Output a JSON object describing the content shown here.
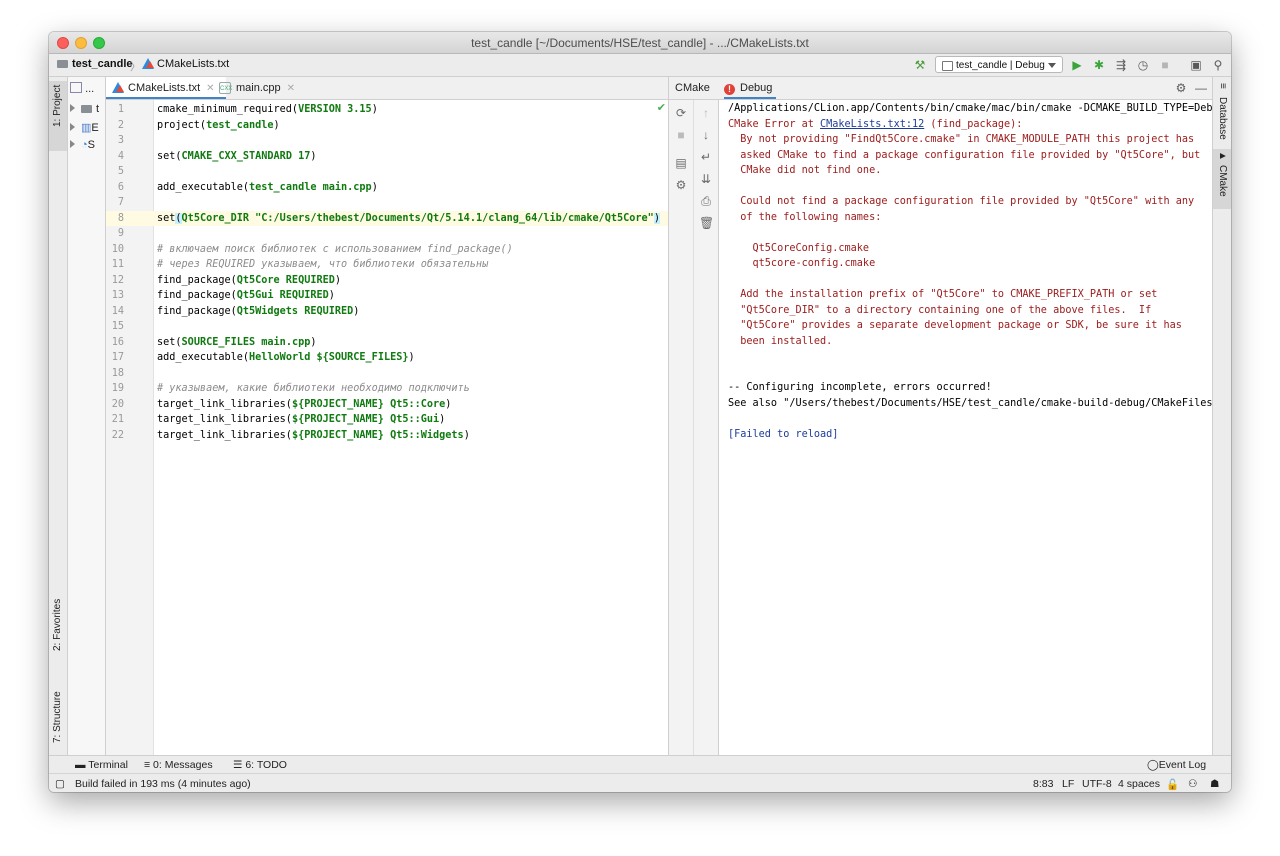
{
  "window": {
    "title": "test_candle [~/Documents/HSE/test_candle] - .../CMakeLists.txt"
  },
  "breadcrumb": {
    "project": "test_candle",
    "file": "CMakeLists.txt"
  },
  "toolbar": {
    "run_config": "test_candle | Debug"
  },
  "left_tool_tabs": {
    "project": "1: Project",
    "favorites": "2: Favorites",
    "structure": "7: Structure"
  },
  "project_tree": {
    "root_label": "...",
    "items": [
      "t",
      "E",
      "S"
    ]
  },
  "editor": {
    "tabs": [
      {
        "label": "CMakeLists.txt",
        "active": true
      },
      {
        "label": "main.cpp",
        "active": false
      }
    ],
    "lines": [
      {
        "n": "1",
        "parts": [
          [
            "",
            "cmake_minimum_required("
          ],
          [
            "kw",
            "VERSION 3.15"
          ],
          [
            "",
            ")"
          ]
        ]
      },
      {
        "n": "2",
        "parts": [
          [
            "",
            "project("
          ],
          [
            "kw",
            "test_candle"
          ],
          [
            "",
            ")"
          ]
        ]
      },
      {
        "n": "3",
        "parts": []
      },
      {
        "n": "4",
        "parts": [
          [
            "",
            "set("
          ],
          [
            "kw",
            "CMAKE_CXX_STANDARD 17"
          ],
          [
            "",
            ")"
          ]
        ]
      },
      {
        "n": "5",
        "parts": []
      },
      {
        "n": "6",
        "parts": [
          [
            "",
            "add_executable("
          ],
          [
            "kw",
            "test_candle main.cpp"
          ],
          [
            "",
            ")"
          ]
        ]
      },
      {
        "n": "7",
        "parts": []
      },
      {
        "n": "8",
        "current": true,
        "parts": [
          [
            "",
            "set"
          ],
          [
            "hl",
            "("
          ],
          [
            "kw",
            "Qt5Core_DIR \"C:/Users/thebest/Documents/Qt/5.14.1/clang_64/lib/cmake/Qt5Core\""
          ],
          [
            "hl",
            ")"
          ]
        ]
      },
      {
        "n": "9",
        "parts": []
      },
      {
        "n": "10",
        "parts": [
          [
            "cm",
            "# включаем поиск библиотек с использованием find_package()"
          ]
        ]
      },
      {
        "n": "11",
        "parts": [
          [
            "cm",
            "# через REQUIRED указываем, что библиотеки обязательны"
          ]
        ]
      },
      {
        "n": "12",
        "parts": [
          [
            "",
            "find_package("
          ],
          [
            "kw",
            "Qt5Core REQUIRED"
          ],
          [
            "",
            ")"
          ]
        ]
      },
      {
        "n": "13",
        "parts": [
          [
            "",
            "find_package("
          ],
          [
            "kw",
            "Qt5Gui REQUIRED"
          ],
          [
            "",
            ")"
          ]
        ]
      },
      {
        "n": "14",
        "parts": [
          [
            "",
            "find_package("
          ],
          [
            "kw",
            "Qt5Widgets REQUIRED"
          ],
          [
            "",
            ")"
          ]
        ]
      },
      {
        "n": "15",
        "parts": []
      },
      {
        "n": "16",
        "parts": [
          [
            "",
            "set("
          ],
          [
            "kw",
            "SOURCE_FILES main.cpp"
          ],
          [
            "",
            ")"
          ]
        ]
      },
      {
        "n": "17",
        "parts": [
          [
            "",
            "add_executable("
          ],
          [
            "kw",
            "HelloWorld ${SOURCE_FILES}"
          ],
          [
            "",
            ")"
          ]
        ]
      },
      {
        "n": "18",
        "parts": []
      },
      {
        "n": "19",
        "parts": [
          [
            "cm",
            "# указываем, какие библиотеки необходимо подключить"
          ]
        ]
      },
      {
        "n": "20",
        "parts": [
          [
            "",
            "target_link_libraries("
          ],
          [
            "kw",
            "${PROJECT_NAME} Qt5::Core"
          ],
          [
            "",
            ")"
          ]
        ]
      },
      {
        "n": "21",
        "parts": [
          [
            "",
            "target_link_libraries("
          ],
          [
            "kw",
            "${PROJECT_NAME} Qt5::Gui"
          ],
          [
            "",
            ")"
          ]
        ]
      },
      {
        "n": "22",
        "parts": [
          [
            "",
            "target_link_libraries("
          ],
          [
            "kw",
            "${PROJECT_NAME} Qt5::Widgets"
          ],
          [
            "",
            ")"
          ]
        ]
      }
    ]
  },
  "cmake_panel": {
    "tab_cmake": "CMake",
    "tab_debug": "Debug",
    "console": [
      {
        "cls": "",
        "text": "/Applications/CLion.app/Contents/bin/cmake/mac/bin/cmake -DCMAKE_BUILD_TYPE=Debug"
      },
      {
        "cls": "err",
        "pre": "CMake Error at ",
        "link": "CMakeLists.txt:12",
        "post": " (find_package):"
      },
      {
        "cls": "err",
        "text": "  By not providing \"FindQt5Core.cmake\" in CMAKE_MODULE_PATH this project has"
      },
      {
        "cls": "err",
        "text": "  asked CMake to find a package configuration file provided by \"Qt5Core\", but"
      },
      {
        "cls": "err",
        "text": "  CMake did not find one."
      },
      {
        "cls": "err",
        "text": ""
      },
      {
        "cls": "err",
        "text": "  Could not find a package configuration file provided by \"Qt5Core\" with any"
      },
      {
        "cls": "err",
        "text": "  of the following names:"
      },
      {
        "cls": "err",
        "text": ""
      },
      {
        "cls": "err",
        "text": "    Qt5CoreConfig.cmake"
      },
      {
        "cls": "err",
        "text": "    qt5core-config.cmake"
      },
      {
        "cls": "err",
        "text": ""
      },
      {
        "cls": "err",
        "text": "  Add the installation prefix of \"Qt5Core\" to CMAKE_PREFIX_PATH or set"
      },
      {
        "cls": "err",
        "text": "  \"Qt5Core_DIR\" to a directory containing one of the above files.  If"
      },
      {
        "cls": "err",
        "text": "  \"Qt5Core\" provides a separate development package or SDK, be sure it has"
      },
      {
        "cls": "err",
        "text": "  been installed."
      },
      {
        "cls": "",
        "text": ""
      },
      {
        "cls": "",
        "text": ""
      },
      {
        "cls": "",
        "text": "-- Configuring incomplete, errors occurred!"
      },
      {
        "cls": "",
        "text": "See also \"/Users/thebest/Documents/HSE/test_candle/cmake-build-debug/CMakeFiles/"
      },
      {
        "cls": "",
        "text": ""
      },
      {
        "cls": "blue",
        "text": "[Failed to reload]"
      }
    ]
  },
  "right_tool_tabs": {
    "database": "Database",
    "cmake": "CMake"
  },
  "bottom_tabs": {
    "terminal": "Terminal",
    "messages": "0: Messages",
    "todo": "6: TODO",
    "event_log": "Event Log"
  },
  "status": {
    "message": "Build failed in 193 ms (4 minutes ago)",
    "position": "8:83",
    "line_sep": "LF",
    "encoding": "UTF-8",
    "indent": "4 spaces"
  }
}
